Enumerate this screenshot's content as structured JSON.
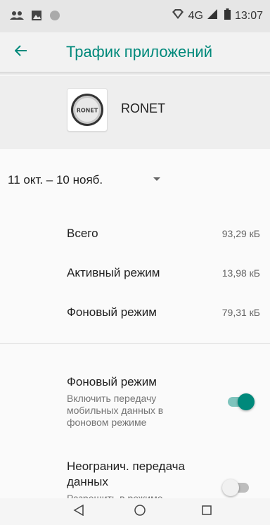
{
  "status_bar": {
    "left_icons": [
      "people-icon",
      "image-icon",
      "circle-icon"
    ],
    "right_icons": [
      "vpn-key-icon",
      "signal-icon",
      "battery-icon"
    ],
    "network": "4G",
    "time": "13:07"
  },
  "app_bar": {
    "back_icon": "arrow-back-icon",
    "title": "Трафик приложений"
  },
  "app": {
    "name": "RONET",
    "icon_text": "RONET"
  },
  "date_range": {
    "label": "11 окт. – 10 нояб."
  },
  "usage": [
    {
      "label": "Всего",
      "value": "93,29 кБ"
    },
    {
      "label": "Активный режим",
      "value": "13,98 кБ"
    },
    {
      "label": "Фоновый режим",
      "value": "79,31 кБ"
    }
  ],
  "settings": [
    {
      "title": "Фоновый режим",
      "summary": "Включить передачу мобильных данных в фоновом режиме",
      "enabled": true
    },
    {
      "title": "Неогранич. передача данных",
      "summary": "Разрешить в режиме",
      "enabled": false
    }
  ],
  "nav_bar": {
    "back": "nav-back-icon",
    "home": "nav-home-icon",
    "recents": "nav-recents-icon"
  },
  "colors": {
    "accent": "#00897b",
    "accent_light": "#7fc4bd",
    "status_bar": "#e6e6e6"
  }
}
